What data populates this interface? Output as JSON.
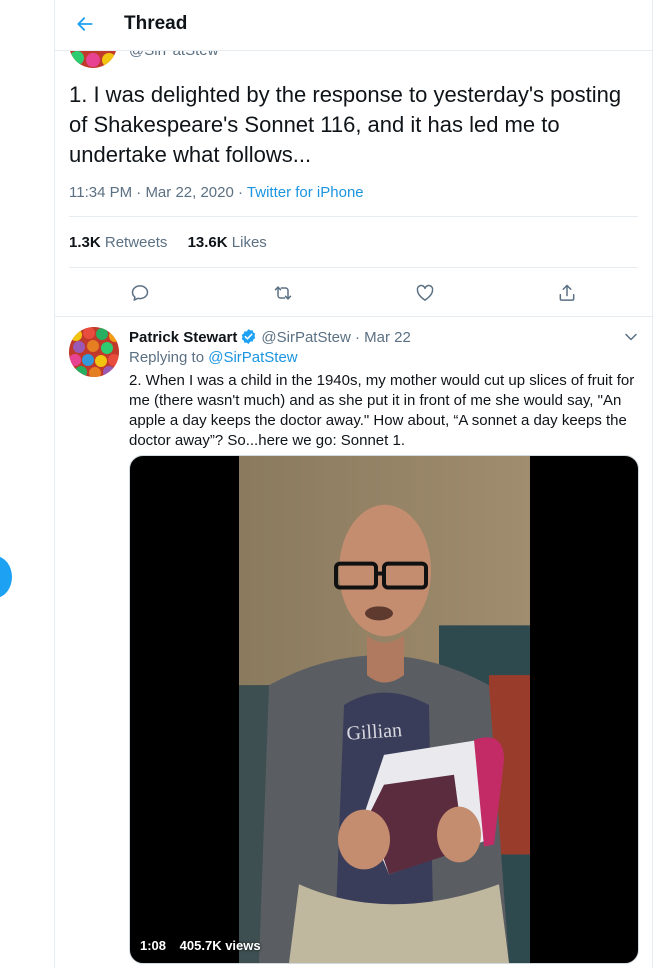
{
  "header": {
    "title": "Thread",
    "back_icon": "arrow-left-icon"
  },
  "main_tweet": {
    "handle": "@SirPatStew",
    "text": "1. I was delighted by the response to yesterday's posting of Shakespeare's Sonnet 116, and it has led me to undertake what follows...",
    "time": "11:34 PM",
    "date": "Mar 22, 2020",
    "separator": "·",
    "source": "Twitter for iPhone",
    "retweets_count": "1.3K",
    "retweets_label": "Retweets",
    "likes_count": "13.6K",
    "likes_label": "Likes",
    "actions": [
      "reply-icon",
      "retweet-icon",
      "like-icon",
      "share-icon"
    ]
  },
  "reply_tweet": {
    "name": "Patrick Stewart",
    "handle": "@SirPatStew",
    "separator": "·",
    "date": "Mar 22",
    "replying_prefix": "Replying to",
    "replying_to": "@SirPatStew",
    "text": "2. When I was a child in the 1940s, my mother would cut up slices of fruit for me (there wasn't much) and as she put it in front of me she would say, \"An apple a day keeps the doctor away.\" How about, “A sonnet a day keeps the doctor away”? So...here we go: Sonnet 1.",
    "video": {
      "duration": "1:08",
      "views": "405.7K views"
    }
  },
  "colors": {
    "accent": "#1da1f2",
    "link": "#1b95e0",
    "secondary_text": "#5b7083",
    "border": "#e6ecf0"
  }
}
